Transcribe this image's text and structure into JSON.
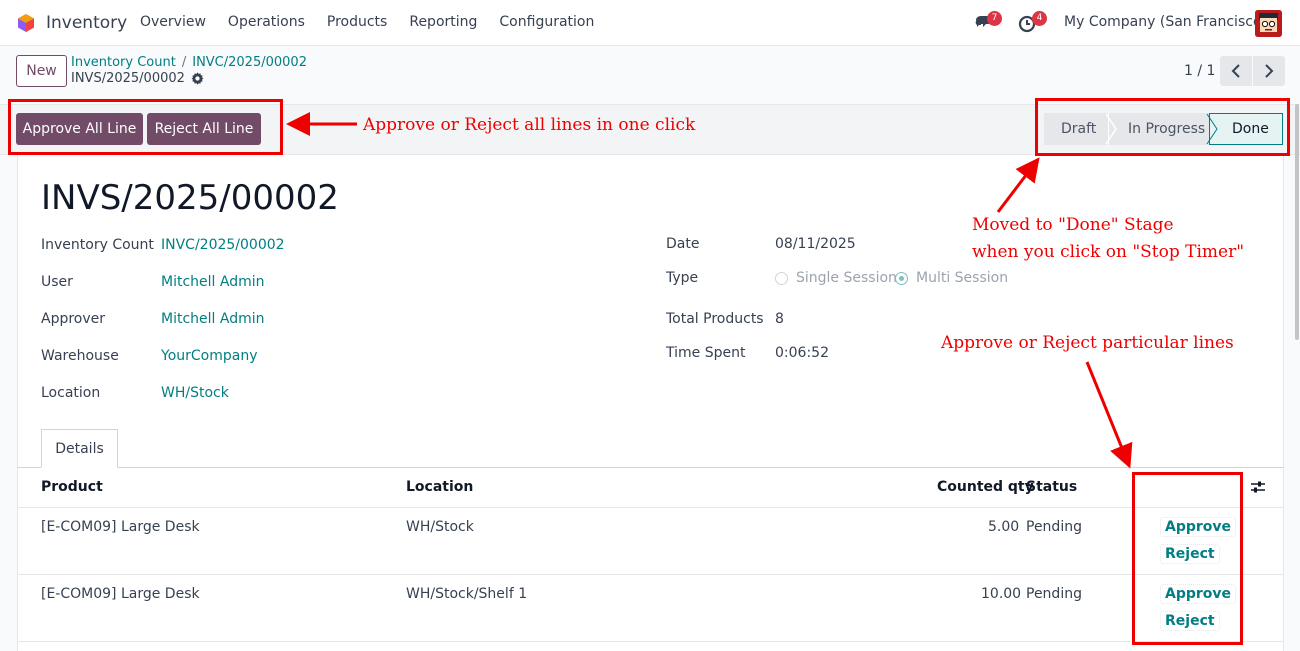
{
  "navbar": {
    "app_name": "Inventory",
    "menu": [
      "Overview",
      "Operations",
      "Products",
      "Reporting",
      "Configuration"
    ],
    "messages_count": "7",
    "activities_count": "4",
    "company": "My Company (San Francisco)"
  },
  "control_panel": {
    "new_label": "New",
    "breadcrumb_parent": "Inventory Count",
    "breadcrumb_mid": "INVC/2025/00002",
    "breadcrumb_current": "INVS/2025/00002",
    "pager": "1 / 1"
  },
  "statusbar": {
    "approve_all": "Approve All Line",
    "reject_all": "Reject All Line",
    "stages": [
      "Draft",
      "In Progress",
      "Done"
    ],
    "active_stage": "Done"
  },
  "record": {
    "title": "INVS/2025/00002",
    "left_fields": [
      {
        "label": "Inventory Count",
        "value": "INVC/2025/00002"
      },
      {
        "label": "User",
        "value": "Mitchell Admin"
      },
      {
        "label": "Approver",
        "value": "Mitchell Admin"
      },
      {
        "label": "Warehouse",
        "value": "YourCompany"
      },
      {
        "label": "Location",
        "value": "WH/Stock"
      }
    ],
    "date_label": "Date",
    "date_value": "08/11/2025",
    "type_label": "Type",
    "type_options": [
      "Single Session",
      "Multi Session"
    ],
    "type_selected": "Multi Session",
    "total_label": "Total Products",
    "total_value": "8",
    "time_label": "Time Spent",
    "time_value": "0:06:52"
  },
  "tabs": [
    "Details"
  ],
  "table": {
    "headers": [
      "Product",
      "Location",
      "Counted qty",
      "Status"
    ],
    "rows": [
      {
        "product": "[E-COM09] Large Desk",
        "location": "WH/Stock",
        "qty": "5.00",
        "status": "Pending",
        "approve": "Approve",
        "reject": "Reject"
      },
      {
        "product": "[E-COM09] Large Desk",
        "location": "WH/Stock/Shelf 1",
        "qty": "10.00",
        "status": "Pending",
        "approve": "Approve",
        "reject": "Reject"
      }
    ]
  },
  "annotations": {
    "top_left": "Approve or Reject all lines in one click",
    "top_right_1": "Moved to \"Done\" Stage",
    "top_right_2": "when you click on \"Stop Timer\"",
    "lines": "Approve or Reject particular lines",
    "color": "#ee0000"
  },
  "colors": {
    "primary": "#714b67",
    "link": "#017e84",
    "badge": "#dc3545"
  }
}
